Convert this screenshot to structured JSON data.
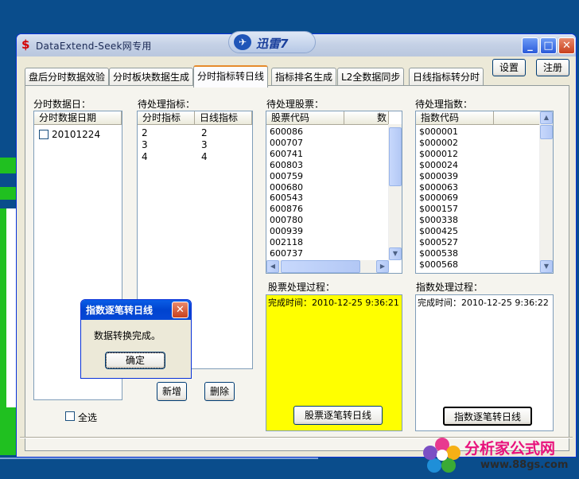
{
  "window": {
    "title": "DataExtend-Seek网专用",
    "app_icon": "$",
    "controls": [
      "minimize-icon",
      "maximize-icon",
      "close-icon"
    ]
  },
  "xunlei_badge": {
    "text": "迅雷7"
  },
  "top_buttons": {
    "settings": "设置",
    "register": "注册"
  },
  "tabs": [
    {
      "label": "盘后分时数据效验"
    },
    {
      "label": "分时板块数据生成"
    },
    {
      "label": "分时指标转日线"
    },
    {
      "label": "指标排名生成"
    },
    {
      "label": "L2全数据同步"
    },
    {
      "label": "日线指标转分时"
    }
  ],
  "active_tab": 2,
  "date_panel": {
    "label": "分时数据日：",
    "header": "分时数据日期",
    "rows": [
      "20101224"
    ]
  },
  "indicator_panel": {
    "label": "待处理指标：",
    "headers": [
      "分时指标",
      "日线指标"
    ],
    "rows": [
      [
        "2",
        "2"
      ],
      [
        "3",
        "3"
      ],
      [
        "4",
        "4"
      ]
    ]
  },
  "stock_panel": {
    "label": "待处理股票：",
    "headers": [
      "股票代码",
      "数"
    ],
    "rows": [
      "600086",
      "000707",
      "600741",
      "600803",
      "000759",
      "000680",
      "600543",
      "600876",
      "000780",
      "000939",
      "002118",
      "600737"
    ]
  },
  "index_panel": {
    "label": "待处理指数：",
    "header": "指数代码",
    "rows": [
      "$000001",
      "$000002",
      "$000012",
      "$000024",
      "$000039",
      "$000063",
      "$000069",
      "$000157",
      "$000338",
      "$000425",
      "$000527",
      "$000538",
      "$000568"
    ]
  },
  "stock_process": {
    "label": "股票处理过程：",
    "log": "完成时间：2010-12-25 9:36:21",
    "bg_color": "#ffff00"
  },
  "index_process": {
    "label": "指数处理过程：",
    "log": "完成时间：2010-12-25 9:36:22"
  },
  "buttons": {
    "add": "新增",
    "delete": "删除",
    "stock_convert": "股票逐笔转日线",
    "index_convert": "指数逐笔转日线"
  },
  "select_all": {
    "label": "全选",
    "checked": false
  },
  "dialog": {
    "title": "指数逐笔转日线",
    "message": "数据转换完成。",
    "ok": "确定"
  },
  "watermark": {
    "brand": "分析家公式网",
    "url": "www.88gs.com"
  }
}
